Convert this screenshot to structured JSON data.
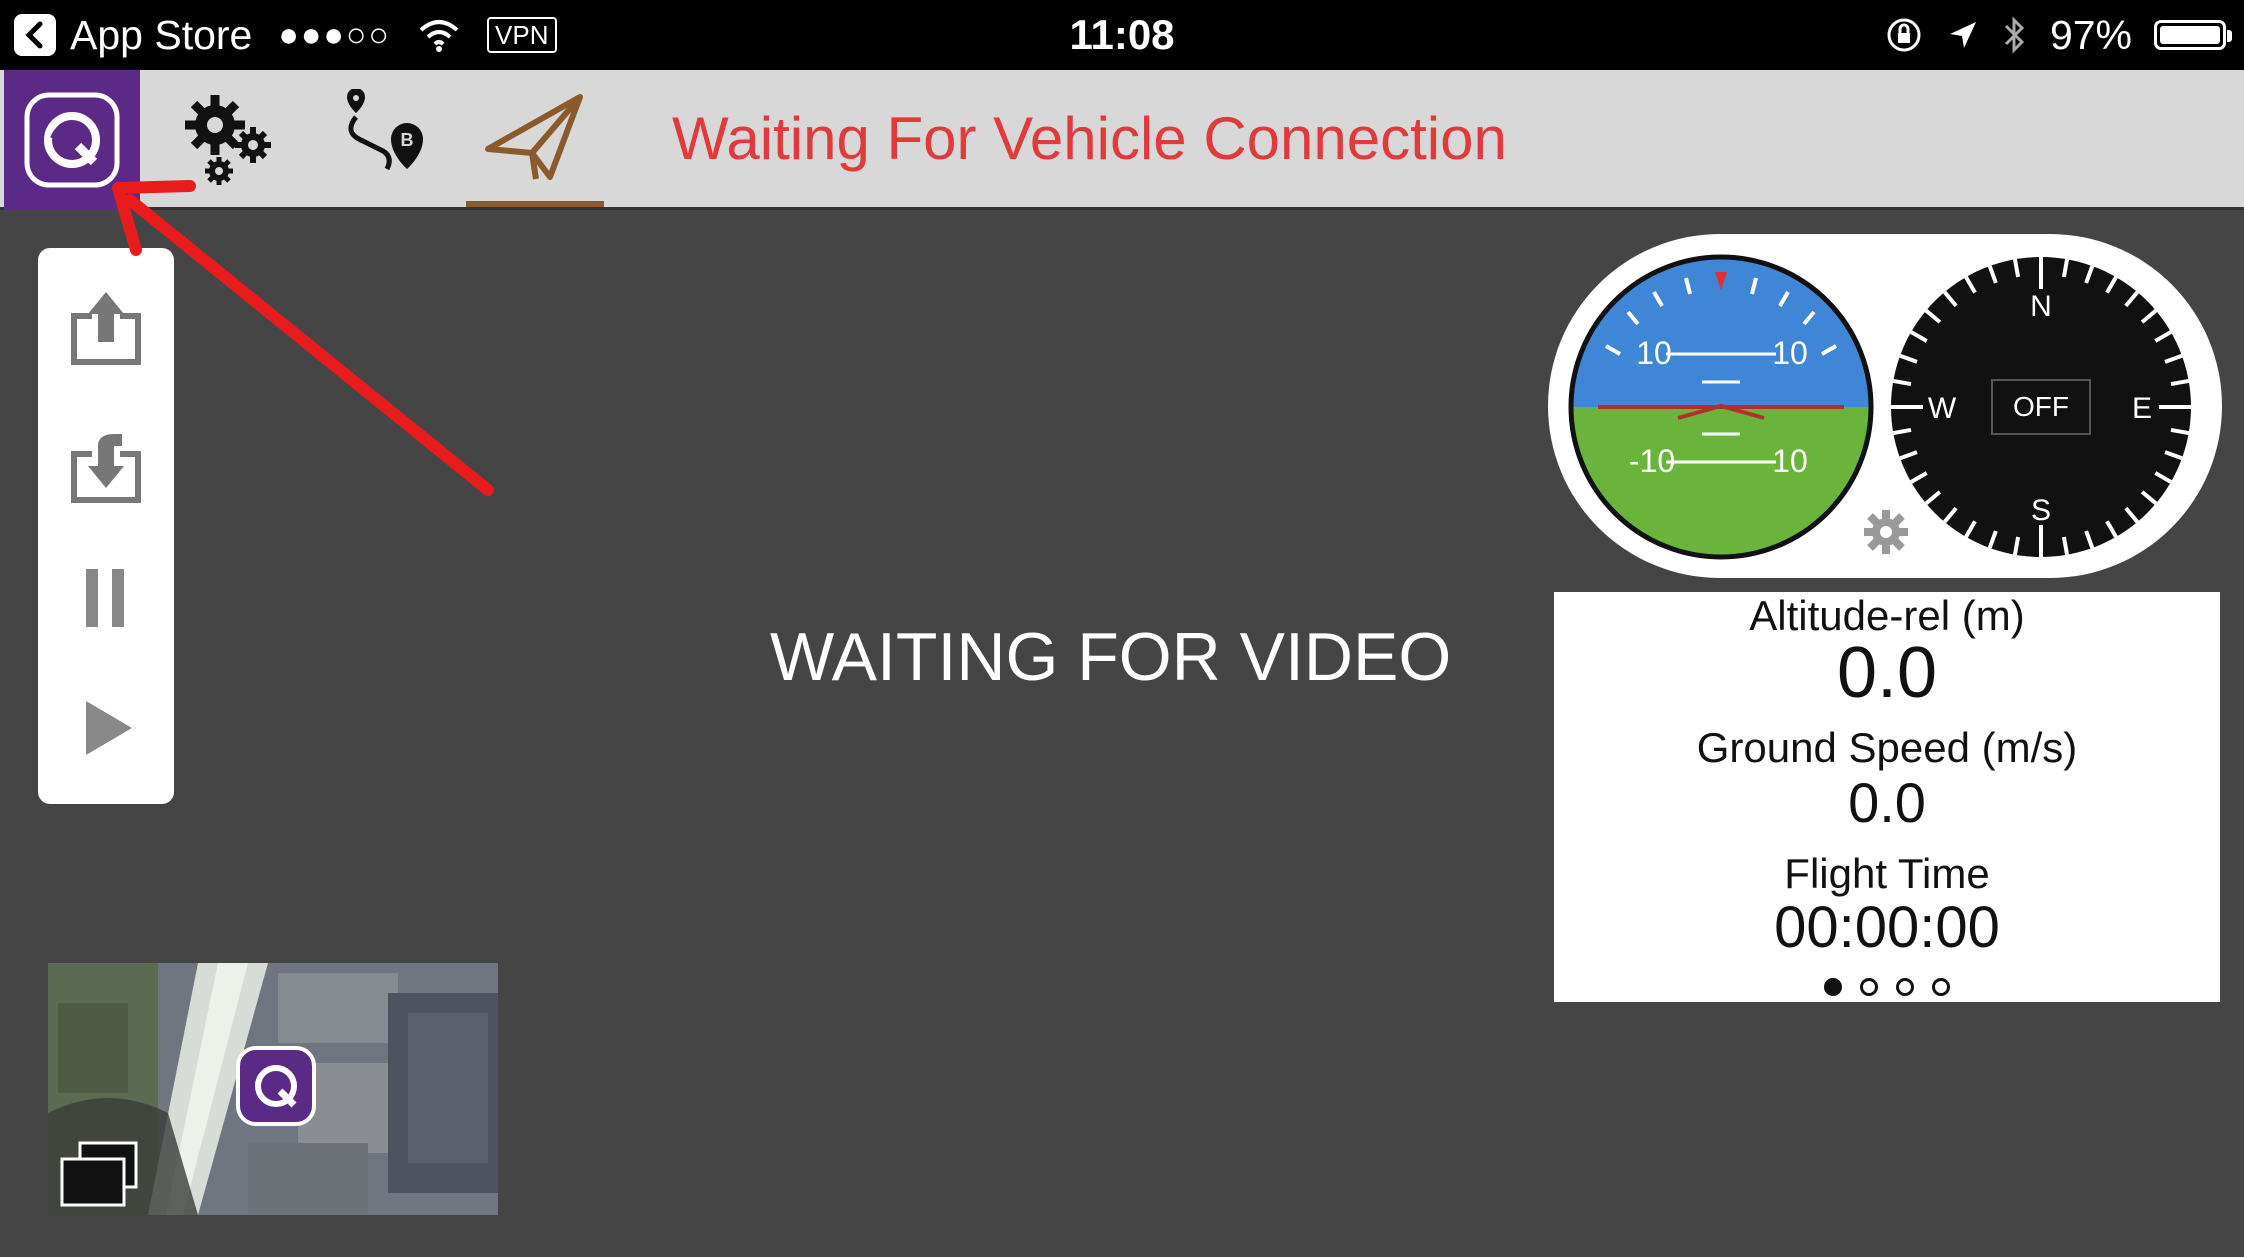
{
  "status_bar": {
    "back_label": "App Store",
    "signal": "●●●○○",
    "vpn": "VPN",
    "time": "11:08",
    "battery": "97%"
  },
  "toolbar": {
    "connection_status": "Waiting For Vehicle Connection",
    "status_color": "#e03a3a",
    "logo_color": "#5b2a86",
    "active_tab": "fly-icon"
  },
  "video": {
    "status": "WAITING FOR VIDEO"
  },
  "attitude_indicator": {
    "upper_left": "10",
    "upper_right": "10",
    "lower_left": "-10",
    "lower_right": "10",
    "sky_color": "#3f86d6",
    "ground_color": "#6ab43c"
  },
  "compass": {
    "north": "N",
    "south": "S",
    "east": "E",
    "west": "W",
    "state": "OFF"
  },
  "telemetry": {
    "altitude_label": "Altitude-rel (m)",
    "altitude_value": "0.0",
    "ground_speed_label": "Ground Speed (m/s)",
    "ground_speed_value": "0.0",
    "flight_time_label": "Flight Time",
    "flight_time_value": "00:00:00",
    "page_count": 4,
    "active_page": 1
  },
  "actions": [
    "upload-icon",
    "download-icon",
    "pause-icon",
    "play-icon"
  ],
  "annotation_color": "#e81c1c"
}
